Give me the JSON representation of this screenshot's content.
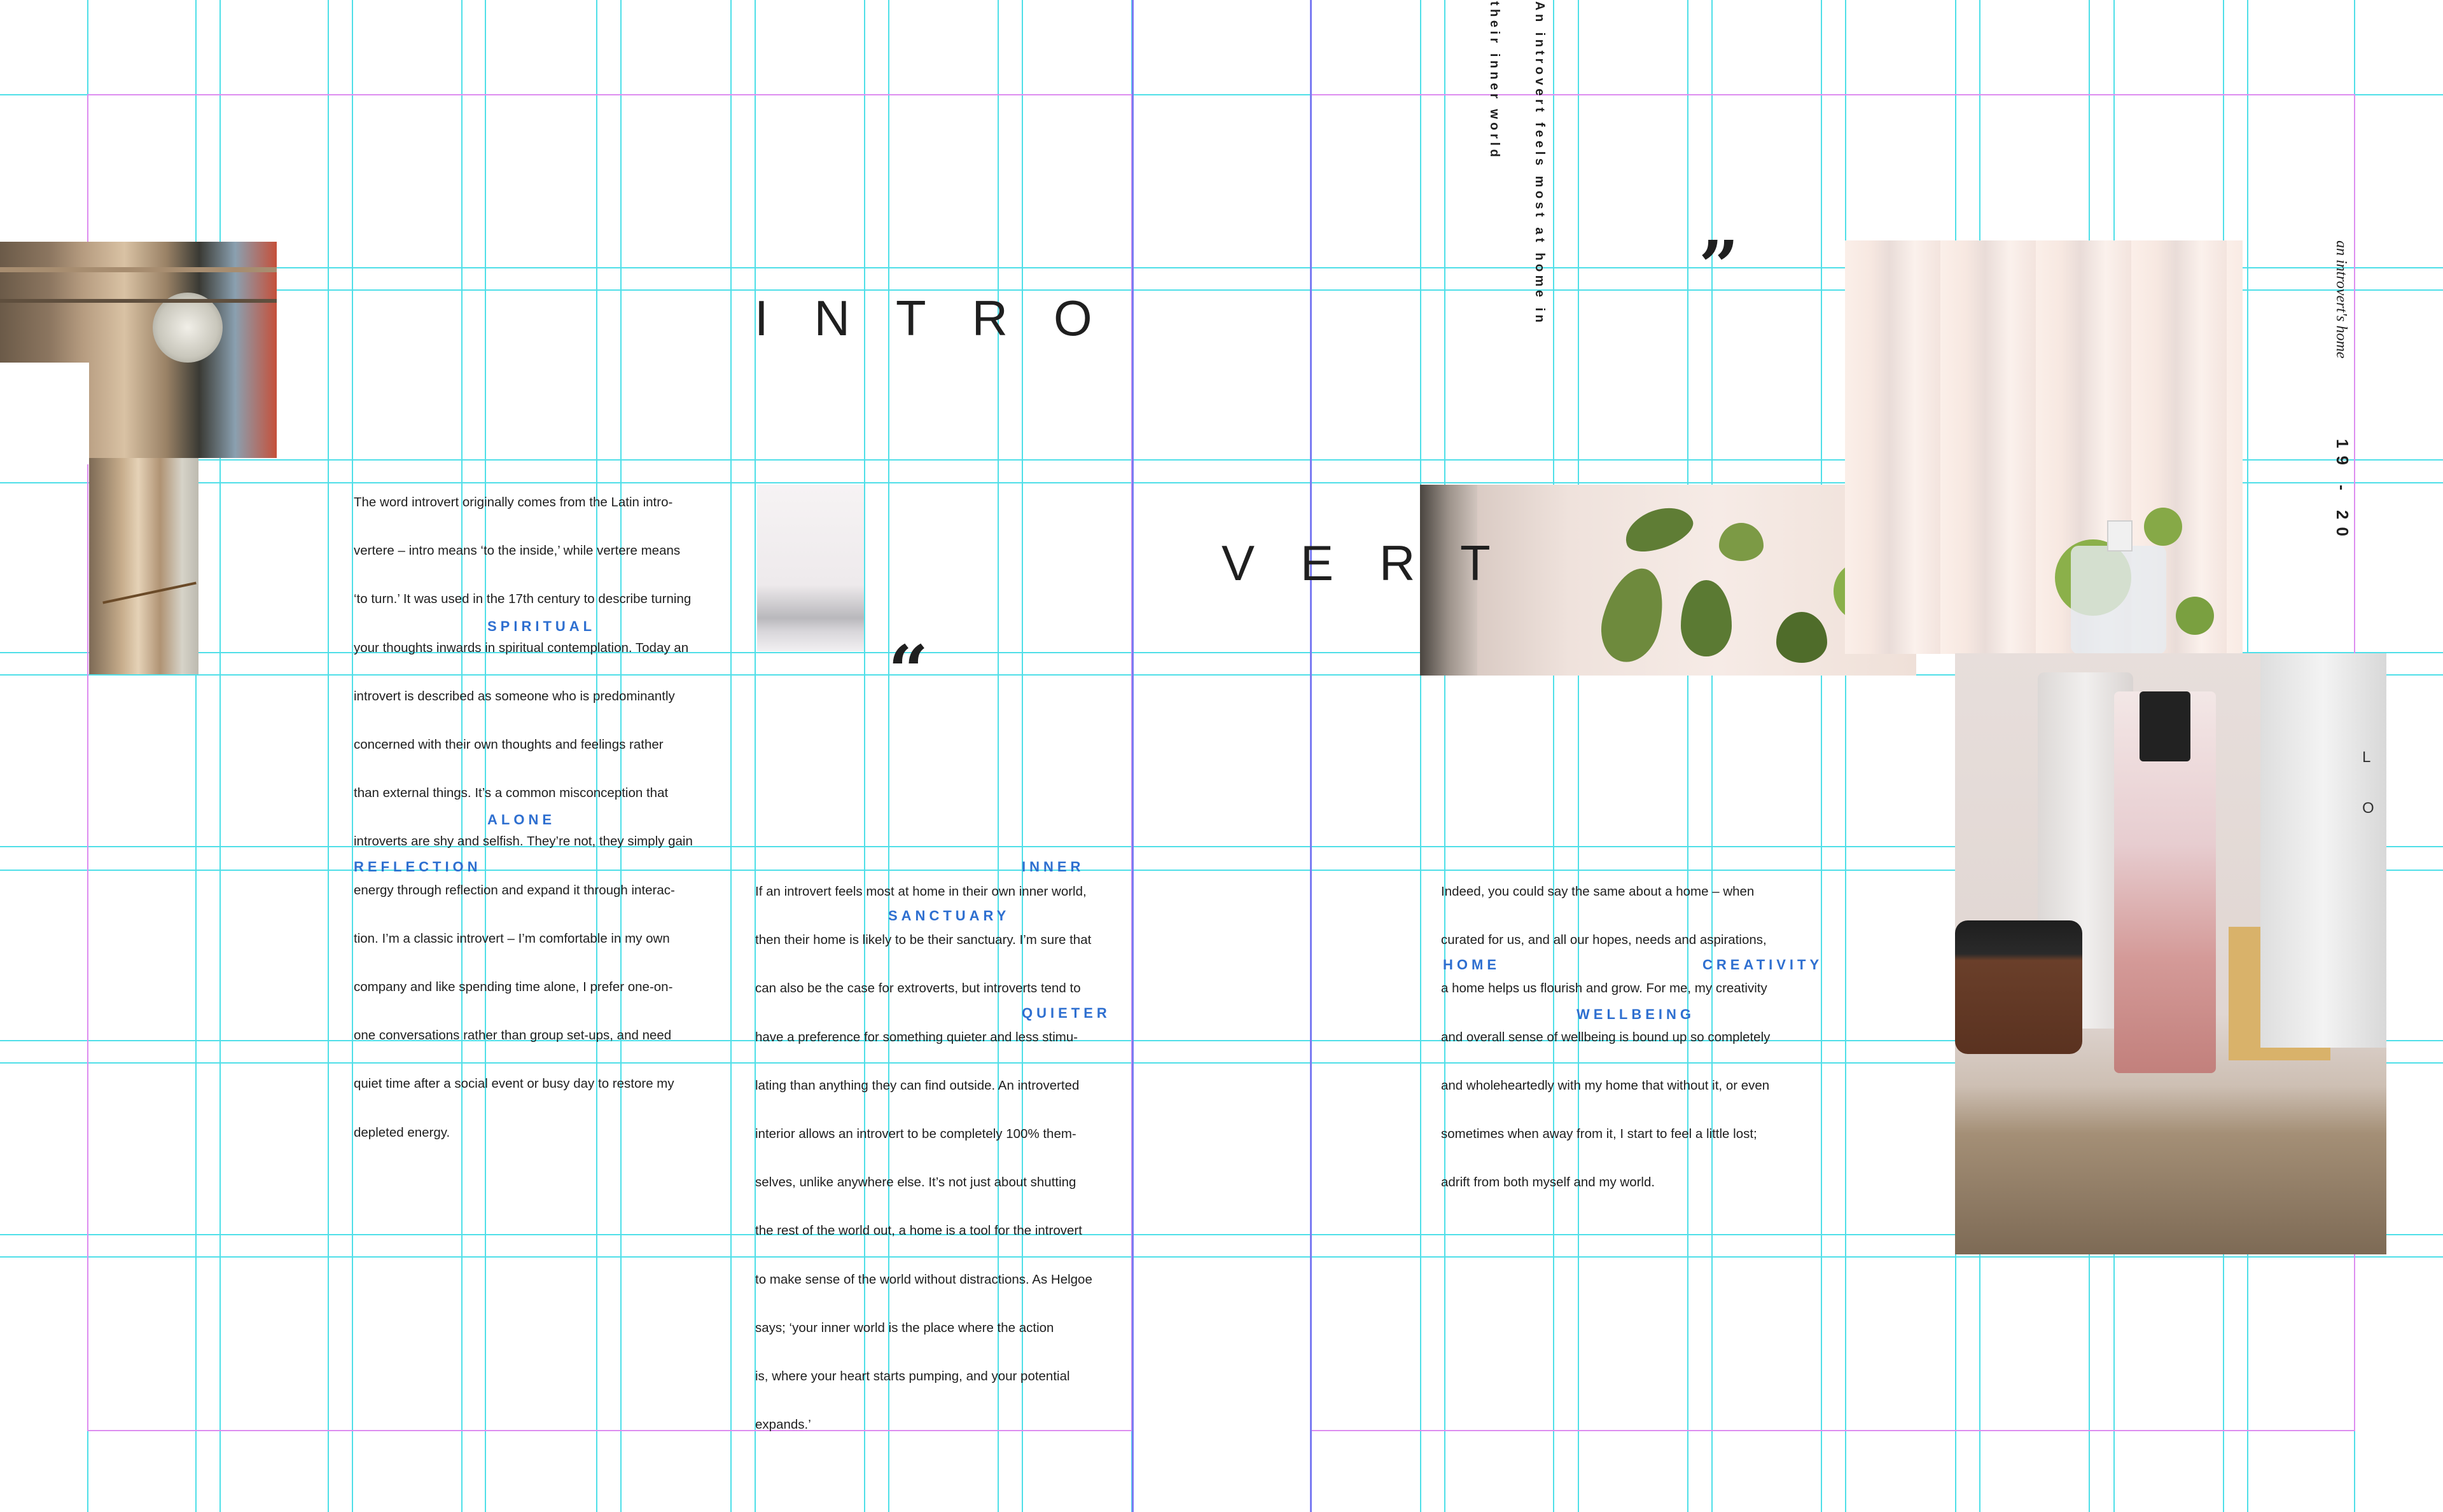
{
  "headline": {
    "part_one": "INTRO",
    "part_two": "VERT"
  },
  "quote_marks": {
    "open": "“",
    "close": "”"
  },
  "pull_quote": {
    "line_one": "An introvert feels most at home in",
    "line_two": "their inner world"
  },
  "running_head": "an introvert's home",
  "folio": "19 - 20",
  "columns": {
    "left": [
      "The word introvert originally comes from the Latin intro-",
      "vertere – intro means ‘to the inside,’ while vertere means",
      "‘to turn.’ It was used in the 17th century to describe turning",
      "your thoughts inwards in spiritual contemplation. Today an",
      "introvert is described as someone who is predominantly",
      "concerned with their own thoughts and feelings rather",
      "than external things. It’s a common misconception that",
      "introverts are shy and selfish. They’re not, they simply gain",
      "energy through reflection and expand it through interac-",
      "tion. I’m a classic introvert – I’m comfortable in my own",
      "company and like spending time alone, I prefer one-on-",
      "one conversations rather than group set-ups, and need",
      "quiet time after a social event or busy day to restore my",
      "depleted energy."
    ],
    "middle": [
      "If an introvert feels most at home in their own inner world,",
      "then their home is likely to be their sanctuary. I’m sure that",
      "can also be the case for extroverts, but introverts tend to",
      "have a preference for something quieter and less stimu-",
      "lating than anything they can find outside. An introverted",
      "interior allows an introvert to be completely 100% them-",
      "selves, unlike anywhere else. It’s not just about shutting",
      "the rest of the world out, a home is a tool for the introvert",
      "to make sense of the world without distractions. As Helgoe",
      "says; ‘your inner world is the place where the action",
      "is, where your heart starts pumping, and your potential",
      "expands.’"
    ],
    "right": [
      "Indeed, you could say the same about a home – when",
      "curated for us, and all our hopes, needs and aspirations,",
      "a home helps us flourish and grow. For me, my creativity",
      "and overall sense of wellbeing is bound up so completely",
      "and wholeheartedly with my home that without it, or even",
      "sometimes when away from it, I start to feel a little lost;",
      "adrift from both myself and my world."
    ]
  },
  "keywords": {
    "spiritual": "SPIRITUAL",
    "alone": "ALONE",
    "reflection": "REFLECTION",
    "inner": "INNER",
    "sanctuary": "SANCTUARY",
    "quieter": "QUIETER",
    "home": "HOME",
    "creativity": "CREATIVITY",
    "wellbeing": "WELLBEING"
  },
  "colors": {
    "keyword_blue": "#2e6fd0",
    "guide_cyan": "#4fdfe8",
    "margin_magenta": "#dd8df0",
    "spine_violet": "#7b7cf2"
  }
}
